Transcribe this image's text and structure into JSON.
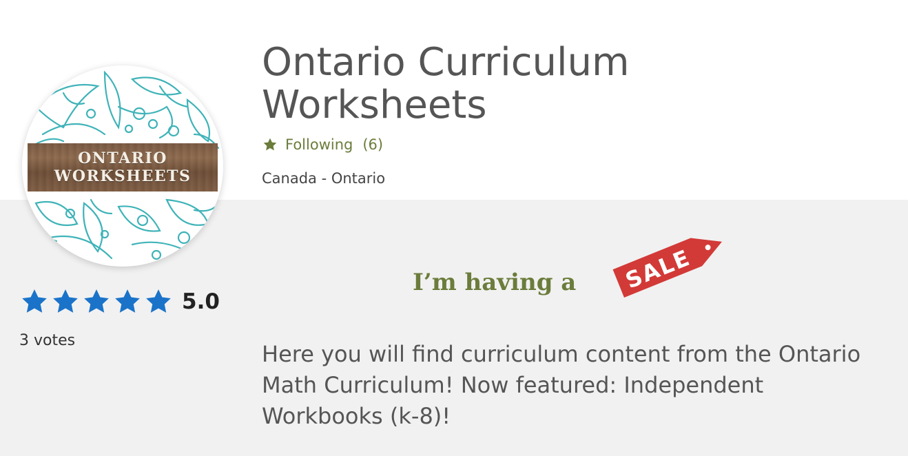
{
  "store": {
    "name": "Ontario Curriculum Worksheets",
    "follow_label": "Following",
    "follow_count": "(6)",
    "location": "Canada - Ontario"
  },
  "avatar": {
    "line1": "ONTARIO",
    "line2": "WORKSHEETS",
    "pattern_color": "#3fb3b8",
    "wood_color": "#7a5a42"
  },
  "rating": {
    "stars": 5,
    "value": "5.0",
    "votes": "3 votes",
    "star_color": "#1a73c9"
  },
  "sale": {
    "intro": "I’m having a",
    "tag_text": "SALE",
    "tag_color": "#d23a37"
  },
  "description": "Here you will find curriculum content from the Ontario Math Curriculum! Now featured: Independent Workbooks (k-8)!",
  "icons": {
    "follow": "star-icon",
    "rating": "star-icon"
  },
  "colors": {
    "accent_green": "#6b7c3b",
    "band_gray": "#f1f1f1"
  }
}
